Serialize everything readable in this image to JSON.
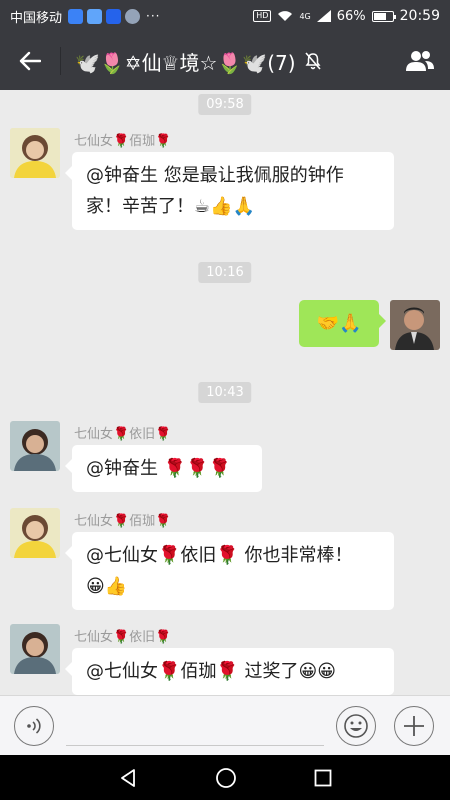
{
  "status_bar": {
    "carrier": "中国移动",
    "dots": "···",
    "network": "4G",
    "battery": "66%",
    "time": "20:59"
  },
  "header": {
    "title": "🕊️🌷✡仙♕境☆🌷🕊️(7)"
  },
  "messages": [
    {
      "time": "09:58"
    },
    {
      "sender": "七仙女🌹佰珈🌹",
      "mention": "@钟奋生",
      "text_line1": "  您是最让我佩服的钟作",
      "text_line2": "家！辛苦了！☕👍🙏"
    },
    {
      "time": "10:16"
    },
    {
      "mine": true,
      "text": "🤝🙏"
    },
    {
      "time": "10:43"
    },
    {
      "sender": "七仙女🌹依旧🌹",
      "text": "@钟奋生  🌹🌹🌹"
    },
    {
      "sender": "七仙女🌹佰珈🌹",
      "text_line1": "@七仙女🌹依旧🌹  你也非常棒！",
      "text_line2": "😀👍"
    },
    {
      "sender": "七仙女🌹依旧🌹",
      "text": "@七仙女🌹佰珈🌹  过奖了😀😀"
    }
  ],
  "input": {
    "value": "",
    "placeholder": ""
  },
  "colors": {
    "header_bg": "#393a3f",
    "chat_bg": "#ebebeb",
    "my_bubble": "#9fe658",
    "other_bubble": "#ffffff"
  },
  "icons": [
    "back-arrow-icon",
    "members-icon",
    "mute-icon",
    "voice-icon",
    "emoji-icon",
    "plus-icon",
    "nav-back-icon",
    "nav-home-icon",
    "nav-recents-icon"
  ]
}
